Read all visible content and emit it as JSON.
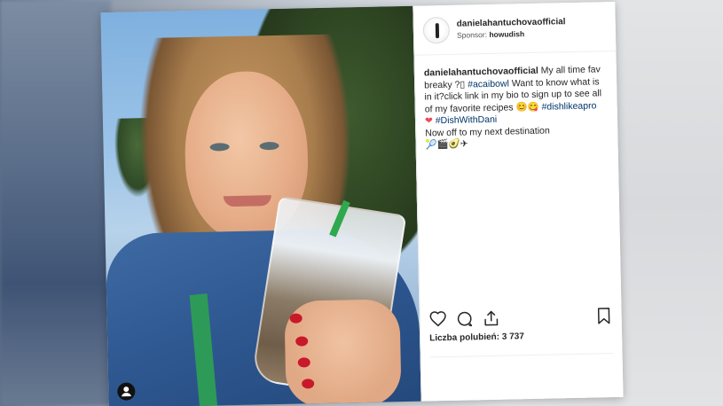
{
  "post": {
    "username": "danielahantuchovaofficial",
    "sponsor_label": "Sponsor:",
    "sponsor_name": "howudish",
    "caption": {
      "user": "danielahantuchovaofficial",
      "text_1": " My all time fav breaky ?",
      "glyph_box": "▯",
      "hashtag_1": "#acaibowl",
      "text_2": " Want to know what is in it?click link in my bio to sign up to see all of my favorite recipes ",
      "emoji_1": "😊😋",
      "hashtag_2": "#dishlikeapro",
      "emoji_heart": "❤",
      "hashtag_3": "#DishWithDani",
      "line_2": "Now off to my next destination",
      "emoji_2": "🎾🎬🥑✈"
    },
    "likes_label": "Liczba polubień: 3 737"
  },
  "icons": {
    "like": "heart-outline-icon",
    "comment": "comment-bubble-icon",
    "share": "share-icon",
    "save": "bookmark-icon",
    "user_tag": "user-tag-icon"
  },
  "colors": {
    "hashtag": "#003569",
    "text": "#262626",
    "heart": "#ed4956"
  }
}
